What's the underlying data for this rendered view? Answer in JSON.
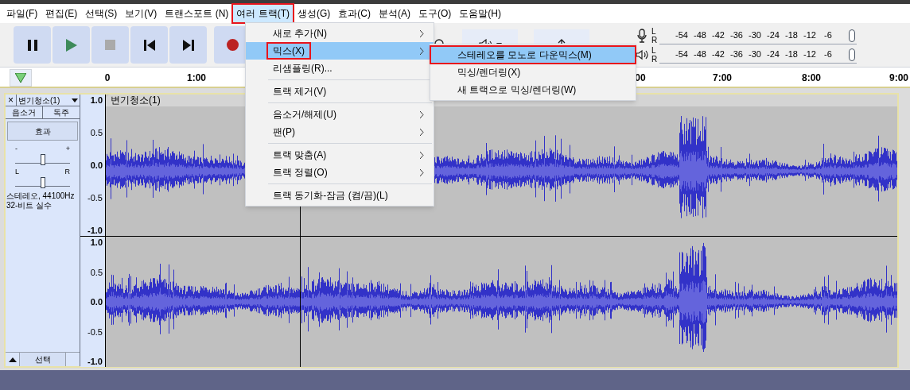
{
  "menu_bar": [
    {
      "label": "파일(F)",
      "open": false,
      "highlighted": false
    },
    {
      "label": "편집(E)",
      "open": false,
      "highlighted": false
    },
    {
      "label": "선택(S)",
      "open": false,
      "highlighted": false
    },
    {
      "label": "보기(V)",
      "open": false,
      "highlighted": false
    },
    {
      "label": "트랜스포트 (N)",
      "open": false,
      "highlighted": false
    },
    {
      "label": "여러 트랙(T)",
      "open": true,
      "highlighted": true
    },
    {
      "label": "생성(G)",
      "open": false,
      "highlighted": false
    },
    {
      "label": "효과(C)",
      "open": false,
      "highlighted": false
    },
    {
      "label": "분석(A)",
      "open": false,
      "highlighted": false
    },
    {
      "label": "도구(O)",
      "open": false,
      "highlighted": false
    },
    {
      "label": "도움말(H)",
      "open": false,
      "highlighted": false
    }
  ],
  "open_menu": {
    "items": [
      {
        "kind": "item",
        "label": "새로 추가(N)",
        "submenu": true,
        "selected": false,
        "highlighted": false
      },
      {
        "kind": "item",
        "label": "믹스(X)",
        "submenu": true,
        "selected": true,
        "highlighted": true
      },
      {
        "kind": "item",
        "label": "리샘플링(R)...",
        "submenu": false,
        "selected": false,
        "highlighted": false
      },
      {
        "kind": "separator"
      },
      {
        "kind": "item",
        "label": "트랙 제거(V)",
        "submenu": false,
        "selected": false,
        "highlighted": false
      },
      {
        "kind": "separator"
      },
      {
        "kind": "item",
        "label": "음소거/해제(U)",
        "submenu": true,
        "selected": false,
        "highlighted": false
      },
      {
        "kind": "item",
        "label": "팬(P)",
        "submenu": true,
        "selected": false,
        "highlighted": false
      },
      {
        "kind": "separator"
      },
      {
        "kind": "item",
        "label": "트랙 맞춤(A)",
        "submenu": true,
        "selected": false,
        "highlighted": false
      },
      {
        "kind": "item",
        "label": "트랙 정렬(O)",
        "submenu": true,
        "selected": false,
        "highlighted": false
      },
      {
        "kind": "separator"
      },
      {
        "kind": "item",
        "label": "트랙 동기화-잠금 (켬/끔)(L)",
        "submenu": false,
        "selected": false,
        "highlighted": false
      }
    ]
  },
  "submenu": {
    "items": [
      {
        "label": "스테레오를 모노로 다운믹스(M)",
        "selected": true,
        "highlighted": true
      },
      {
        "label": "믹싱/렌더링(X)",
        "selected": false,
        "highlighted": false
      },
      {
        "label": "새 트랙으로 믹싱/렌더링(W)",
        "selected": false,
        "highlighted": false
      }
    ]
  },
  "meters": [
    {
      "kind": "record",
      "channels": [
        "L",
        "R"
      ],
      "ticks": [
        "-54",
        "-48",
        "-42",
        "-36",
        "-30",
        "-24",
        "-18",
        "-12",
        "-6"
      ]
    },
    {
      "kind": "playback",
      "channels": [
        "L",
        "R"
      ],
      "ticks": [
        "-54",
        "-48",
        "-42",
        "-36",
        "-30",
        "-24",
        "-18",
        "-12",
        "-6"
      ]
    }
  ],
  "ruler": {
    "labels": [
      "0",
      "1:00",
      "00",
      "7:00",
      "8:00",
      "9:00"
    ]
  },
  "track": {
    "close": "×",
    "name": "변기청소(1)",
    "mute": "음소거",
    "solo": "독주",
    "effects": "효과",
    "gain": {
      "minus": "-",
      "plus": "+",
      "level": 0.5
    },
    "pan": {
      "left": "L",
      "right": "R",
      "level": 0.5
    },
    "info": [
      "스테레오, 44100Hz",
      "32-비트 실수"
    ],
    "select": "선택",
    "clip_title": "변기청소(1)",
    "channels": [
      {
        "scale": [
          "1.0",
          "0.5",
          "0.0",
          "-0.5",
          "-1.0"
        ]
      },
      {
        "scale": [
          "1.0",
          "0.5",
          "0.0",
          "-0.5",
          "-1.0"
        ]
      }
    ]
  }
}
